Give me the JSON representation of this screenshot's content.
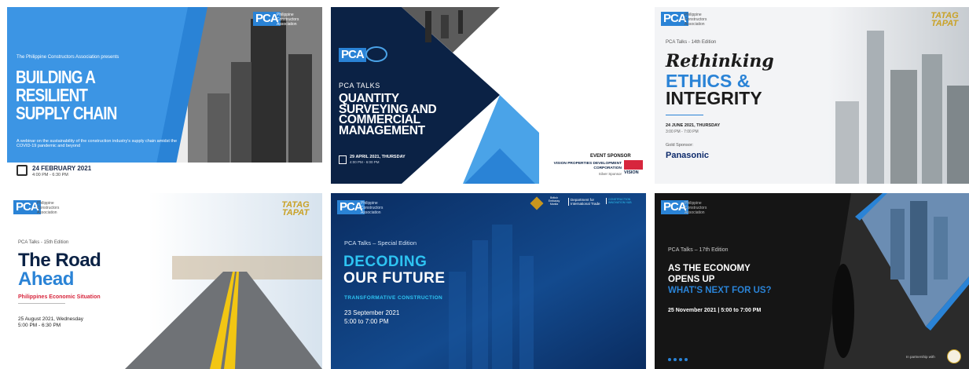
{
  "cards": [
    {
      "logo": "PCA",
      "org": "Philippine Constructors Association",
      "presenter": "The Philippine Constructors Association presents",
      "title_lines": [
        "BUILDING A",
        "RESILIENT",
        "SUPPLY CHAIN"
      ],
      "subtitle": "A webinar on the sustainability of the construction industry's supply chain amidst the COVID-19 pandemic and beyond",
      "date": "24 FEBRUARY 2021",
      "time": "4:00 PM - 6:30 PM",
      "icon": "calendar-icon"
    },
    {
      "logo": "PCA",
      "eyebrow": "PCA TALKS",
      "title_lines": [
        "QUANTITY",
        "SURVEYING AND",
        "COMMERCIAL",
        "MANAGEMENT"
      ],
      "date": "29 APRIL 2021, THURSDAY",
      "time": "4:00 PM - 6:00 PM",
      "sponsor_label": "EVENT SPONSOR",
      "sponsor_name": "VISION PROPERTIES DEVELOPMENT CORPORATION",
      "sponsor_tier": "Silver Sponsor",
      "sponsor_logo": "VISION"
    },
    {
      "logo": "PCA",
      "org": "Philippine Constructors Association",
      "badge": "TATAG TAPAT",
      "edition": "PCA Talks - 14th Edition",
      "script_title": "Rethinking",
      "title_line1": "ETHICS &",
      "title_line2": "INTEGRITY",
      "date": "24 JUNE 2021, THURSDAY",
      "time": "3:00 PM - 7:00 PM",
      "sponsor_label": "Gold Sponsor:",
      "sponsor_name": "Panasonic"
    },
    {
      "logo": "PCA",
      "org": "Philippine Constructors Association",
      "badge": "TATAG TAPAT",
      "edition": "PCA Talks - 15th Edition",
      "title_line1": "The Road",
      "title_line2": "Ahead",
      "subtitle": "Philippines Economic Situation",
      "date": "25 August 2021, Wednesday",
      "time": "5:00 PM - 6:30 PM"
    },
    {
      "logo": "PCA",
      "org": "Philippine Constructors Association",
      "edition": "PCA Talks – Special Edition",
      "title_line1": "DECODING",
      "title_line2": "OUR FUTURE",
      "subtitle": "TRANSFORMATIVE CONSTRUCTION",
      "date": "23 September 2021",
      "time": "5:00 to 7:00 PM",
      "partner_dept": "Department for International Trade",
      "partner_embassy": "British Embassy Manila",
      "partner_other": "CONSTRUCTION INNOVATION HUB"
    },
    {
      "logo": "PCA",
      "org": "Philippine Constructors Association",
      "edition": "PCA Talks – 17th Edition",
      "title_line1": "AS THE ECONOMY",
      "title_line2": "OPENS UP",
      "title_line3": "WHAT'S NEXT FOR US?",
      "datetime": "25 November 2021  |  5:00 to 7:00 PM",
      "partner_label": "In partnership with"
    }
  ],
  "colors": {
    "pca_blue": "#2a83d6",
    "navy": "#0b2245",
    "red": "#d7263d",
    "cyan": "#2ec4f2",
    "gold": "#c9a227"
  }
}
